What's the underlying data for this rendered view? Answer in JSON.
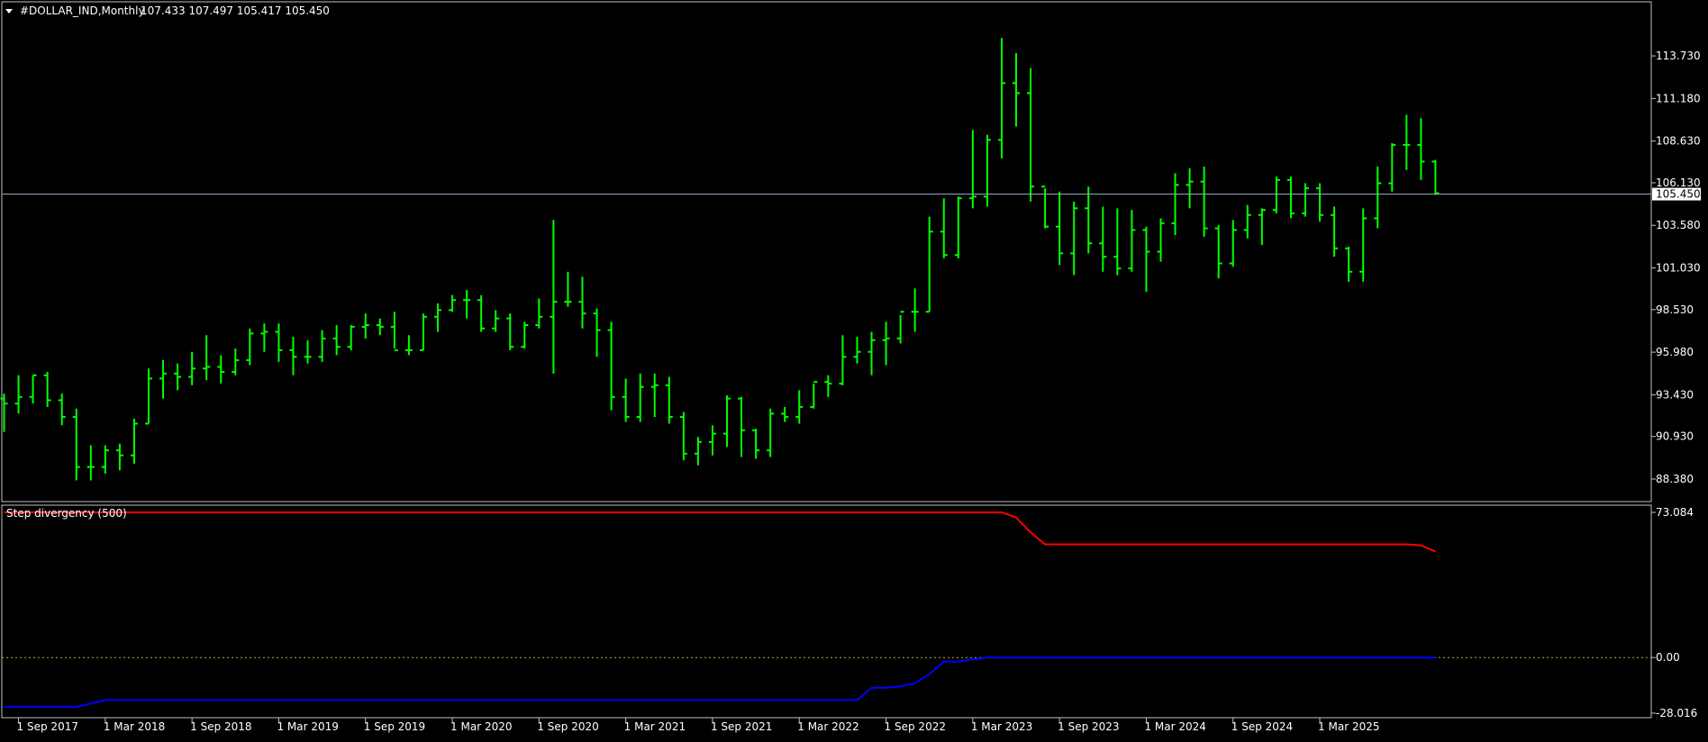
{
  "chart_data": [
    {
      "type": "ohlc",
      "title": "#DOLLAR_IND,Monthly",
      "ohlc_readout": "107.433 107.497 105.417 105.450",
      "y_ticks": [
        "113.730",
        "111.180",
        "108.630",
        "106.130",
        "103.580",
        "101.030",
        "98.530",
        "95.980",
        "93.430",
        "90.930",
        "88.380"
      ],
      "ylim": [
        87.3,
        116.0
      ],
      "current_price": 105.45,
      "current_price_label": "105.450",
      "x_ticks": [
        "1 Sep 2017",
        "1 Mar 2018",
        "1 Sep 2018",
        "1 Mar 2019",
        "1 Sep 2019",
        "1 Mar 2020",
        "1 Sep 2020",
        "1 Mar 2021",
        "1 Sep 2021",
        "1 Mar 2022",
        "1 Sep 2022",
        "1 Mar 2023",
        "1 Sep 2023",
        "1 Mar 2024",
        "1 Sep 2024",
        "1 Mar 2025"
      ],
      "x_start": "2017-08",
      "bar_color": "#00ff00",
      "bars": [
        [
          93.2,
          93.5,
          91.2,
          92.9
        ],
        [
          92.9,
          94.6,
          92.3,
          93.3
        ],
        [
          93.3,
          94.6,
          92.9,
          94.6
        ],
        [
          94.6,
          94.8,
          92.7,
          93.1
        ],
        [
          93.1,
          93.5,
          91.6,
          92.1
        ],
        [
          92.1,
          92.6,
          88.3,
          89.1
        ],
        [
          89.1,
          90.4,
          88.3,
          89.1
        ],
        [
          89.1,
          90.4,
          88.7,
          90.1
        ],
        [
          90.1,
          90.5,
          88.9,
          89.8
        ],
        [
          89.8,
          92.0,
          89.3,
          91.7
        ],
        [
          91.7,
          95.0,
          91.7,
          94.4
        ],
        [
          94.4,
          95.5,
          93.2,
          94.7
        ],
        [
          94.7,
          95.3,
          93.7,
          94.5
        ],
        [
          94.5,
          96.0,
          94.0,
          95.0
        ],
        [
          95.0,
          97.0,
          94.3,
          95.1
        ],
        [
          95.1,
          95.8,
          94.1,
          94.8
        ],
        [
          94.8,
          96.2,
          94.6,
          95.5
        ],
        [
          95.5,
          97.4,
          95.2,
          97.1
        ],
        [
          97.1,
          97.7,
          96.0,
          97.2
        ],
        [
          97.2,
          97.7,
          95.4,
          96.1
        ],
        [
          96.1,
          96.9,
          94.6,
          95.7
        ],
        [
          95.7,
          96.7,
          95.3,
          95.7
        ],
        [
          95.7,
          97.3,
          95.4,
          96.8
        ],
        [
          96.8,
          97.6,
          95.8,
          96.3
        ],
        [
          96.3,
          97.6,
          96.1,
          97.5
        ],
        [
          97.5,
          98.3,
          96.8,
          97.6
        ],
        [
          97.6,
          98.0,
          97.0,
          97.5
        ],
        [
          97.5,
          98.4,
          96.2,
          96.1
        ],
        [
          96.1,
          97.0,
          95.8,
          96.1
        ],
        [
          96.1,
          98.3,
          96.1,
          98.1
        ],
        [
          98.1,
          98.9,
          97.2,
          98.5
        ],
        [
          98.5,
          99.4,
          98.4,
          99.1
        ],
        [
          99.1,
          99.7,
          98.0,
          99.1
        ],
        [
          99.1,
          99.4,
          97.2,
          97.4
        ],
        [
          97.4,
          98.5,
          97.2,
          98.0
        ],
        [
          98.0,
          98.3,
          96.1,
          96.3
        ],
        [
          96.3,
          97.8,
          96.2,
          97.6
        ],
        [
          97.6,
          99.2,
          97.4,
          98.1
        ],
        [
          98.1,
          103.9,
          94.7,
          99.0
        ],
        [
          99.0,
          100.8,
          98.7,
          99.0
        ],
        [
          99.0,
          100.5,
          97.4,
          98.3
        ],
        [
          98.3,
          98.6,
          95.7,
          97.3
        ],
        [
          97.3,
          97.8,
          92.5,
          93.3
        ],
        [
          93.3,
          94.4,
          91.8,
          92.1
        ],
        [
          92.1,
          94.7,
          91.8,
          93.9
        ],
        [
          93.9,
          94.7,
          92.1,
          94.0
        ],
        [
          94.0,
          94.5,
          91.7,
          92.1
        ],
        [
          92.1,
          92.4,
          89.5,
          89.9
        ],
        [
          89.9,
          90.9,
          89.2,
          90.6
        ],
        [
          90.6,
          91.6,
          89.8,
          91.1
        ],
        [
          91.1,
          93.4,
          90.3,
          93.2
        ],
        [
          93.2,
          93.3,
          89.7,
          91.3
        ],
        [
          91.3,
          91.4,
          89.6,
          90.1
        ],
        [
          90.1,
          92.6,
          89.7,
          92.3
        ],
        [
          92.3,
          92.7,
          91.8,
          92.1
        ],
        [
          92.1,
          93.7,
          91.7,
          92.7
        ],
        [
          92.7,
          94.1,
          92.6,
          94.2
        ],
        [
          94.2,
          94.6,
          93.3,
          94.1
        ],
        [
          94.1,
          97.0,
          94.0,
          95.7
        ],
        [
          95.7,
          96.9,
          95.3,
          96.0
        ],
        [
          96.0,
          97.2,
          94.6,
          96.7
        ],
        [
          96.7,
          97.8,
          95.2,
          96.8
        ],
        [
          96.8,
          98.2,
          96.5,
          98.4
        ],
        [
          98.4,
          99.8,
          97.2,
          98.4
        ],
        [
          98.4,
          104.1,
          98.4,
          103.2
        ],
        [
          103.2,
          105.2,
          101.6,
          101.8
        ],
        [
          101.8,
          105.3,
          101.6,
          105.2
        ],
        [
          105.2,
          109.3,
          104.6,
          105.3
        ],
        [
          105.3,
          109.0,
          104.7,
          108.7
        ],
        [
          108.7,
          114.8,
          107.6,
          112.1
        ],
        [
          112.1,
          113.9,
          109.5,
          111.5
        ],
        [
          111.5,
          113.0,
          105.0,
          105.9
        ],
        [
          105.9,
          105.8,
          103.4,
          103.5
        ],
        [
          103.5,
          105.6,
          101.2,
          101.9
        ],
        [
          101.9,
          105.0,
          100.6,
          104.6
        ],
        [
          104.6,
          105.9,
          101.9,
          102.5
        ],
        [
          102.5,
          104.7,
          100.8,
          101.7
        ],
        [
          101.7,
          104.6,
          100.6,
          101.0
        ],
        [
          101.0,
          104.5,
          100.8,
          103.3
        ],
        [
          103.3,
          103.5,
          99.6,
          102.0
        ],
        [
          102.0,
          104.0,
          101.4,
          103.7
        ],
        [
          103.7,
          106.7,
          103.0,
          106.0
        ],
        [
          106.0,
          107.0,
          104.6,
          106.2
        ],
        [
          106.2,
          107.1,
          102.9,
          103.4
        ],
        [
          103.4,
          103.6,
          100.4,
          101.3
        ],
        [
          101.3,
          103.9,
          101.1,
          103.3
        ],
        [
          103.3,
          104.8,
          102.8,
          104.2
        ],
        [
          104.2,
          104.6,
          102.4,
          104.5
        ],
        [
          104.5,
          106.5,
          104.3,
          106.3
        ],
        [
          106.3,
          106.5,
          104.0,
          104.3
        ],
        [
          104.3,
          106.1,
          104.1,
          105.8
        ],
        [
          105.8,
          106.1,
          103.8,
          104.2
        ],
        [
          104.2,
          104.7,
          101.7,
          102.2
        ],
        [
          102.2,
          102.3,
          100.2,
          100.8
        ],
        [
          100.8,
          104.6,
          100.2,
          104.0
        ],
        [
          104.0,
          107.1,
          103.4,
          106.1
        ],
        [
          106.1,
          108.5,
          105.6,
          108.4
        ],
        [
          108.4,
          110.2,
          106.9,
          108.4
        ],
        [
          108.4,
          110.0,
          106.3,
          107.4
        ],
        [
          107.4,
          107.5,
          105.4,
          105.5
        ]
      ]
    },
    {
      "type": "line",
      "indicator_label": "Step divergency (500)",
      "y_ticks": [
        "73.084",
        "0.00",
        "-28.016"
      ],
      "ylim": [
        -28.016,
        73.084
      ],
      "zero_line_color": "#c8a050",
      "series": [
        {
          "color": "#ff0000",
          "values": [
            73.084,
            73.084,
            73.084,
            73.084,
            73.084,
            73.084,
            73.084,
            73.084,
            73.084,
            73.084,
            73.084,
            73.084,
            73.084,
            73.084,
            73.084,
            73.084,
            73.084,
            73.084,
            73.084,
            73.084,
            73.084,
            73.084,
            73.084,
            73.084,
            73.084,
            73.084,
            73.084,
            73.084,
            73.084,
            73.084,
            73.084,
            73.084,
            73.084,
            73.084,
            73.084,
            73.084,
            73.084,
            73.084,
            73.084,
            73.084,
            73.084,
            73.084,
            73.084,
            73.084,
            73.084,
            73.084,
            73.084,
            73.084,
            73.084,
            73.084,
            73.084,
            73.084,
            73.084,
            73.084,
            73.084,
            73.084,
            73.084,
            73.084,
            73.084,
            73.084,
            73.084,
            73.084,
            73.084,
            73.084,
            73.084,
            73.084,
            73.084,
            73.084,
            73.084,
            73.084,
            70.5,
            63,
            57,
            57,
            57,
            57,
            57,
            57,
            57,
            57,
            57,
            57,
            57,
            57,
            57,
            57,
            57,
            57,
            57,
            57,
            57,
            57,
            57,
            57,
            57,
            57,
            57,
            57,
            56.5,
            53.3
          ]
        },
        {
          "color": "#0000ff",
          "values": [
            -24.8,
            -24.8,
            -24.8,
            -24.8,
            -24.8,
            -24.8,
            -23.2,
            -21.4,
            -21.4,
            -21.4,
            -21.4,
            -21.4,
            -21.4,
            -21.4,
            -21.4,
            -21.4,
            -21.4,
            -21.4,
            -21.4,
            -21.4,
            -21.4,
            -21.4,
            -21.4,
            -21.4,
            -21.4,
            -21.4,
            -21.4,
            -21.4,
            -21.4,
            -21.4,
            -21.4,
            -21.4,
            -21.4,
            -21.4,
            -21.4,
            -21.4,
            -21.4,
            -21.4,
            -21.4,
            -21.4,
            -21.4,
            -21.4,
            -21.4,
            -21.4,
            -21.4,
            -21.4,
            -21.4,
            -21.4,
            -21.4,
            -21.4,
            -21.4,
            -21.4,
            -21.4,
            -21.4,
            -21.4,
            -21.4,
            -21.4,
            -21.4,
            -21.4,
            -21.4,
            -15.2,
            -15.2,
            -14.5,
            -12.9,
            -8.3,
            -2.1,
            -2.0,
            -1.0,
            0,
            0,
            0,
            0,
            0,
            0,
            0,
            0,
            0,
            0,
            0,
            0,
            0,
            0,
            0,
            0,
            0,
            0,
            0,
            0,
            0,
            0,
            0,
            0,
            0,
            0,
            0,
            0,
            0,
            0,
            0,
            0
          ]
        }
      ]
    }
  ]
}
